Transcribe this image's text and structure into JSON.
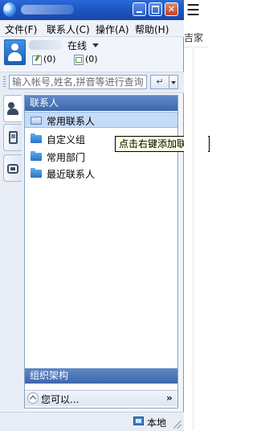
{
  "window": {
    "minimize_glyph": "",
    "maximize_glyph": "",
    "close_glyph": "✕"
  },
  "menu": [
    {
      "label": "文件(F)"
    },
    {
      "label": "联系人(C)"
    },
    {
      "label": "操作(A)"
    },
    {
      "label": "帮助(H)"
    }
  ],
  "profile": {
    "status": "在线",
    "message_count": "(0)",
    "file_count": "(0)"
  },
  "search": {
    "placeholder": "输入帐号,姓名,拼音等进行查询",
    "enter_glyph": "↵"
  },
  "side_tabs": [
    {
      "icon": "contacts-icon"
    },
    {
      "icon": "phone-icon"
    },
    {
      "icon": "group-icon"
    }
  ],
  "panel": {
    "header": "联系人",
    "groups": [
      {
        "label": "常用联系人",
        "selected": true
      },
      {
        "label": "自定义组"
      },
      {
        "label": "常用部门"
      },
      {
        "label": "最近联系人"
      }
    ],
    "org_label": "组织架构",
    "maybe_label": "您可以...",
    "more_glyph": "»"
  },
  "statusbar": {
    "local_label": "本地"
  },
  "tooltip": {
    "text": "点击右键添加联系人"
  },
  "background_app": {
    "menu_glyph": "☰",
    "text": "吉家"
  },
  "colors": {
    "title_blue": "#1f55c2",
    "header_blue": "#4a72b5",
    "selection": "#c6dbf7",
    "tooltip_bg": "#ffffe1"
  }
}
